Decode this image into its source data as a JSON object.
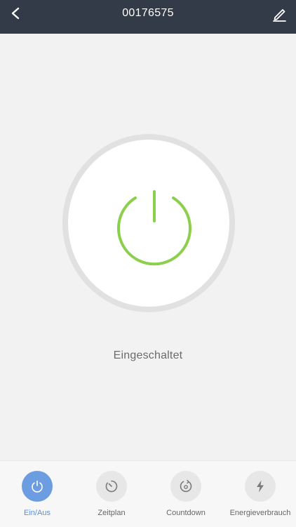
{
  "header": {
    "title": "00176575",
    "back_icon": "chevron-left-icon",
    "edit_icon": "pencil-icon"
  },
  "power": {
    "state": "on",
    "status_text": "Eingeschaltet",
    "icon": "power-icon",
    "icon_color": "#8ccf4d"
  },
  "tabs": [
    {
      "label": "Ein/Aus",
      "icon": "power-icon",
      "active": true
    },
    {
      "label": "Zeitplan",
      "icon": "clock-icon",
      "active": false
    },
    {
      "label": "Countdown",
      "icon": "countdown-icon",
      "active": false
    },
    {
      "label": "Energieverbrauch",
      "icon": "lightning-icon",
      "active": false
    }
  ],
  "colors": {
    "header_bg": "#343b48",
    "accent": "#6b9de0",
    "power_on": "#8ccf4d"
  }
}
